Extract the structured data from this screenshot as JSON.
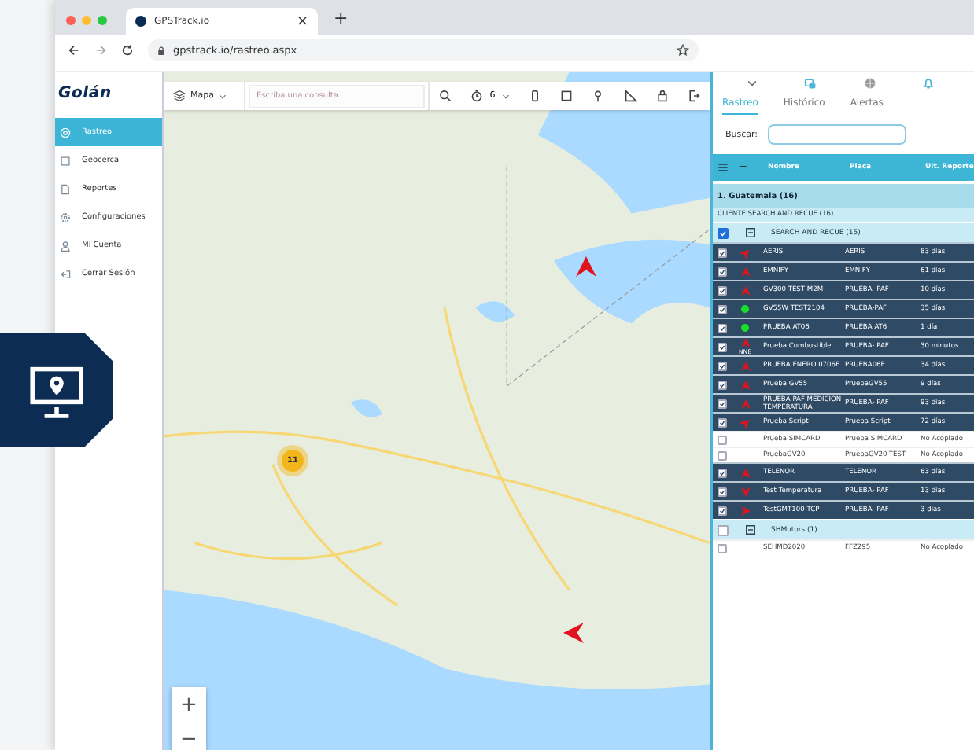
{
  "browser": {
    "tab_title": "GPSTrack.io",
    "tab_close": "×",
    "new_tab": "+",
    "url": "gpstrack.io/rastreo.aspx"
  },
  "sidebar": {
    "logo": "Golán",
    "items": [
      {
        "label": "Rastreo",
        "selected": true
      },
      {
        "label": "Geocerca",
        "selected": false
      },
      {
        "label": "Reportes",
        "selected": false
      },
      {
        "label": "Configuraciones",
        "selected": false
      },
      {
        "label": "Mi Cuenta",
        "selected": false
      },
      {
        "label": "Cerrar Sesión",
        "selected": false
      }
    ]
  },
  "map_toolbar": {
    "layer": "Mapa",
    "search": {
      "placeholder": "Escriba una consulta"
    },
    "timer_value": "6"
  },
  "map": {
    "cluster": "11",
    "zoom_in": "+",
    "zoom_out": "−"
  },
  "panel": {
    "tabs": [
      {
        "label": "Rastreo",
        "selected": true
      },
      {
        "label": "Histórico",
        "selected": false
      },
      {
        "label": "Alertas",
        "selected": false
      }
    ],
    "search_label": "Buscar:",
    "columns": [
      "—",
      "Nombre",
      "Placa",
      "Ult. Reporte"
    ],
    "region": "1. Guatemala (16)",
    "client": "CLIENTE SEARCH AND RECUE (16)",
    "groups": [
      {
        "name": "SEARCH AND RECUE (15)",
        "checked": true,
        "rows": [
          {
            "name": "AERIS",
            "plate": "AERIS",
            "report": "83 días",
            "checked": true,
            "kind": "northeast"
          },
          {
            "name": "EMNIFY",
            "plate": "EMNIFY",
            "report": "61 días",
            "checked": true,
            "kind": "north"
          },
          {
            "name": "GV300 TEST M2M",
            "plate": "PRUEBA- PAF",
            "report": "10 días",
            "checked": true,
            "kind": "north"
          },
          {
            "name": "GV55W TEST2104",
            "plate": "PRUEBA-PAF",
            "report": "35 días",
            "checked": true,
            "kind": "dot"
          },
          {
            "name": "PRUEBA AT06",
            "plate": "PRUEBA AT6",
            "report": "1 día",
            "checked": true,
            "kind": "dot"
          },
          {
            "name": "Prueba Combustible",
            "plate": "PRUEBA- PAF",
            "report": "30 minutos",
            "checked": true,
            "kind": "north",
            "heading_label": "NNE"
          },
          {
            "name": "PRUEBA ENERO 0706E",
            "plate": "PRUEBA06E",
            "report": "34 días",
            "checked": true,
            "kind": "north"
          },
          {
            "name": "Prueba GV55",
            "plate": "PruebaGV55",
            "report": "9 días",
            "checked": true,
            "kind": "north"
          },
          {
            "name": "PRUEBA PAF MEDICIÓN TEMPERATURA",
            "plate": "PRUEBA- PAF",
            "report": "93 días",
            "checked": true,
            "kind": "north"
          },
          {
            "name": "Prueba Script",
            "plate": "Prueba Script",
            "report": "72 días",
            "checked": true,
            "kind": "northeast"
          },
          {
            "name": "Prueba SIMCARD",
            "plate": "Prueba SIMCARD",
            "report": "No Acoplado",
            "checked": false,
            "kind": "none"
          },
          {
            "name": "PruebaGV20",
            "plate": "PruebaGV20-TEST",
            "report": "No Acoplado",
            "checked": false,
            "kind": "none"
          },
          {
            "name": "TELENOR",
            "plate": "TELENOR",
            "report": "63 días",
            "checked": true,
            "kind": "north"
          },
          {
            "name": "Test Temperatura",
            "plate": "PRUEBA- PAF",
            "report": "13 días",
            "checked": true,
            "kind": "south"
          },
          {
            "name": "TestGMT100 TCP",
            "plate": "PRUEBA- PAF",
            "report": "3 días",
            "checked": true,
            "kind": "east"
          }
        ]
      },
      {
        "name": "SHMotors (1)",
        "checked": false,
        "rows": [
          {
            "name": "SEHMD2020",
            "plate": "FFZ295",
            "report": "No Acoplado",
            "checked": false,
            "kind": "none"
          }
        ]
      }
    ]
  }
}
